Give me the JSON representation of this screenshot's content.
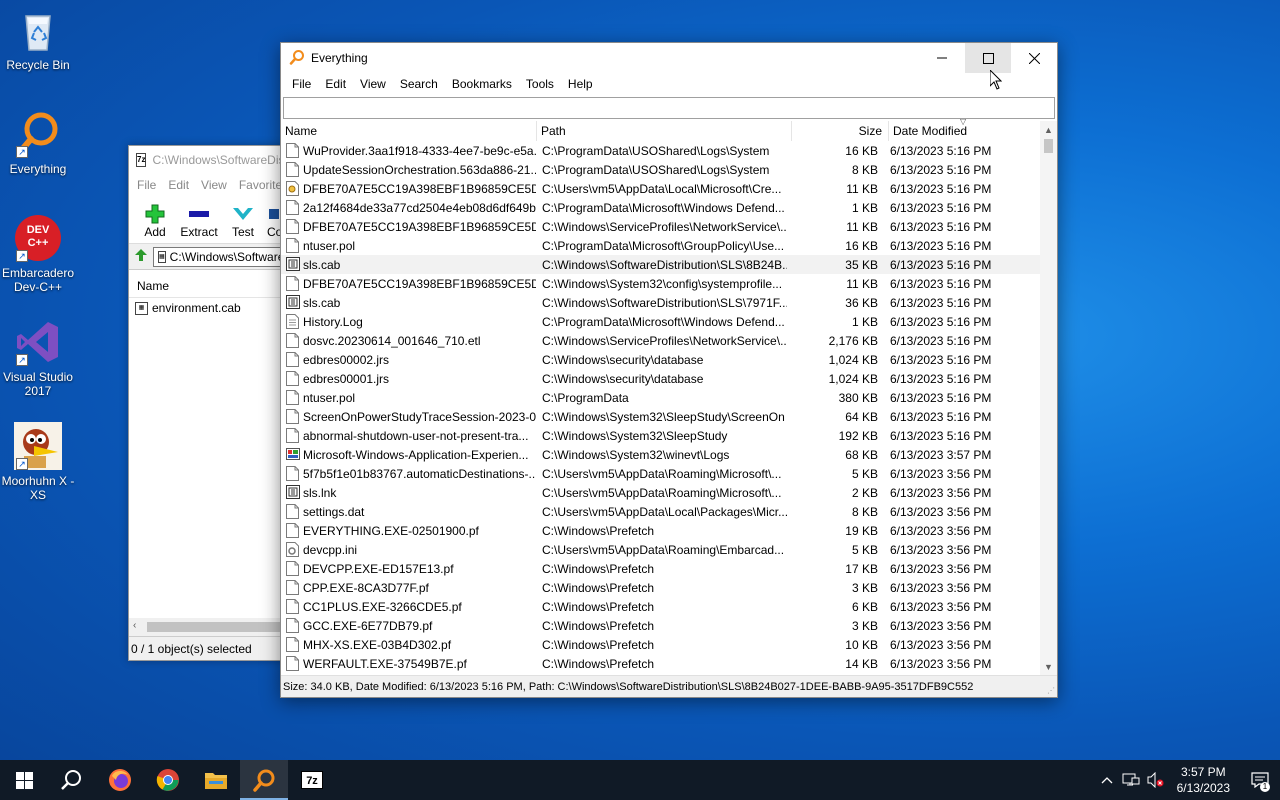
{
  "desktop": {
    "icons": [
      {
        "label": "Recycle Bin",
        "icon": "recycle-bin-icon"
      },
      {
        "label": "Everything",
        "icon": "everything-icon"
      },
      {
        "label": "Embarcadero Dev-C++",
        "icon": "devcpp-icon",
        "glyph_text": "DEV C++"
      },
      {
        "label": "Visual Studio 2017",
        "icon": "visual-studio-icon"
      },
      {
        "label": "Moorhuhn X - XS",
        "icon": "moorhuhn-icon"
      }
    ]
  },
  "sevenzip": {
    "title": "C:\\Windows\\SoftwareDistribution\\SLS\\",
    "app_icon_text": "7z",
    "menu": [
      "File",
      "Edit",
      "View",
      "Favorites"
    ],
    "toolbar": [
      {
        "label": "Add",
        "icon": "add-plus-icon"
      },
      {
        "label": "Extract",
        "icon": "extract-minus-icon"
      },
      {
        "label": "Test",
        "icon": "test-check-icon"
      },
      {
        "label": "Copy",
        "icon": "copy-icon"
      }
    ],
    "address": "C:\\Windows\\SoftwareDistribution\\SLS\\",
    "column_name": "Name",
    "files": [
      "environment.cab"
    ],
    "status": "0 / 1 object(s) selected"
  },
  "everything": {
    "title": "Everything",
    "menu": [
      "File",
      "Edit",
      "View",
      "Search",
      "Bookmarks",
      "Tools",
      "Help"
    ],
    "search_value": "",
    "columns": {
      "name": "Name",
      "path": "Path",
      "size": "Size",
      "date": "Date Modified"
    },
    "rows": [
      {
        "name": "WuProvider.3aa1f918-4333-4ee7-be9c-e5a...",
        "path": "C:\\ProgramData\\USOShared\\Logs\\System",
        "size": "16 KB",
        "date": "6/13/2023 5:16 PM",
        "icon": "file"
      },
      {
        "name": "UpdateSessionOrchestration.563da886-21...",
        "path": "C:\\ProgramData\\USOShared\\Logs\\System",
        "size": "8 KB",
        "date": "6/13/2023 5:16 PM",
        "icon": "file"
      },
      {
        "name": "DFBE70A7E5CC19A398EBF1B96859CE5D",
        "path": "C:\\Users\\vm5\\AppData\\Local\\Microsoft\\Cre...",
        "size": "11 KB",
        "date": "6/13/2023 5:16 PM",
        "icon": "cert"
      },
      {
        "name": "2a12f4684de33a77cd2504e4eb08d6df649b...",
        "path": "C:\\ProgramData\\Microsoft\\Windows Defend...",
        "size": "1 KB",
        "date": "6/13/2023 5:16 PM",
        "icon": "file"
      },
      {
        "name": "DFBE70A7E5CC19A398EBF1B96859CE5D",
        "path": "C:\\Windows\\ServiceProfiles\\NetworkService\\...",
        "size": "11 KB",
        "date": "6/13/2023 5:16 PM",
        "icon": "file"
      },
      {
        "name": "ntuser.pol",
        "path": "C:\\ProgramData\\Microsoft\\GroupPolicy\\Use...",
        "size": "16 KB",
        "date": "6/13/2023 5:16 PM",
        "icon": "file"
      },
      {
        "name": "sls.cab",
        "path": "C:\\Windows\\SoftwareDistribution\\SLS\\8B24B...",
        "size": "35 KB",
        "date": "6/13/2023 5:16 PM",
        "icon": "archive",
        "selected": true
      },
      {
        "name": "DFBE70A7E5CC19A398EBF1B96859CE5D",
        "path": "C:\\Windows\\System32\\config\\systemprofile...",
        "size": "11 KB",
        "date": "6/13/2023 5:16 PM",
        "icon": "file"
      },
      {
        "name": "sls.cab",
        "path": "C:\\Windows\\SoftwareDistribution\\SLS\\7971F...",
        "size": "36 KB",
        "date": "6/13/2023 5:16 PM",
        "icon": "archive"
      },
      {
        "name": "History.Log",
        "path": "C:\\ProgramData\\Microsoft\\Windows Defend...",
        "size": "1 KB",
        "date": "6/13/2023 5:16 PM",
        "icon": "text"
      },
      {
        "name": "dosvc.20230614_001646_710.etl",
        "path": "C:\\Windows\\ServiceProfiles\\NetworkService\\...",
        "size": "2,176 KB",
        "date": "6/13/2023 5:16 PM",
        "icon": "file"
      },
      {
        "name": "edbres00002.jrs",
        "path": "C:\\Windows\\security\\database",
        "size": "1,024 KB",
        "date": "6/13/2023 5:16 PM",
        "icon": "file"
      },
      {
        "name": "edbres00001.jrs",
        "path": "C:\\Windows\\security\\database",
        "size": "1,024 KB",
        "date": "6/13/2023 5:16 PM",
        "icon": "file"
      },
      {
        "name": "ntuser.pol",
        "path": "C:\\ProgramData",
        "size": "380 KB",
        "date": "6/13/2023 5:16 PM",
        "icon": "file"
      },
      {
        "name": "ScreenOnPowerStudyTraceSession-2023-0...",
        "path": "C:\\Windows\\System32\\SleepStudy\\ScreenOn",
        "size": "64 KB",
        "date": "6/13/2023 5:16 PM",
        "icon": "file"
      },
      {
        "name": "abnormal-shutdown-user-not-present-tra...",
        "path": "C:\\Windows\\System32\\SleepStudy",
        "size": "192 KB",
        "date": "6/13/2023 5:16 PM",
        "icon": "file"
      },
      {
        "name": "Microsoft-Windows-Application-Experien...",
        "path": "C:\\Windows\\System32\\winevt\\Logs",
        "size": "68 KB",
        "date": "6/13/2023 3:57 PM",
        "icon": "evtx"
      },
      {
        "name": "5f7b5f1e01b83767.automaticDestinations-...",
        "path": "C:\\Users\\vm5\\AppData\\Roaming\\Microsoft\\...",
        "size": "5 KB",
        "date": "6/13/2023 3:56 PM",
        "icon": "file"
      },
      {
        "name": "sls.lnk",
        "path": "C:\\Users\\vm5\\AppData\\Roaming\\Microsoft\\...",
        "size": "2 KB",
        "date": "6/13/2023 3:56 PM",
        "icon": "archive"
      },
      {
        "name": "settings.dat",
        "path": "C:\\Users\\vm5\\AppData\\Local\\Packages\\Micr...",
        "size": "8 KB",
        "date": "6/13/2023 3:56 PM",
        "icon": "file"
      },
      {
        "name": "EVERYTHING.EXE-02501900.pf",
        "path": "C:\\Windows\\Prefetch",
        "size": "19 KB",
        "date": "6/13/2023 3:56 PM",
        "icon": "file"
      },
      {
        "name": "devcpp.ini",
        "path": "C:\\Users\\vm5\\AppData\\Roaming\\Embarcad...",
        "size": "5 KB",
        "date": "6/13/2023 3:56 PM",
        "icon": "ini"
      },
      {
        "name": "DEVCPP.EXE-ED157E13.pf",
        "path": "C:\\Windows\\Prefetch",
        "size": "17 KB",
        "date": "6/13/2023 3:56 PM",
        "icon": "file"
      },
      {
        "name": "CPP.EXE-8CA3D77F.pf",
        "path": "C:\\Windows\\Prefetch",
        "size": "3 KB",
        "date": "6/13/2023 3:56 PM",
        "icon": "file"
      },
      {
        "name": "CC1PLUS.EXE-3266CDE5.pf",
        "path": "C:\\Windows\\Prefetch",
        "size": "6 KB",
        "date": "6/13/2023 3:56 PM",
        "icon": "file"
      },
      {
        "name": "GCC.EXE-6E77DB79.pf",
        "path": "C:\\Windows\\Prefetch",
        "size": "3 KB",
        "date": "6/13/2023 3:56 PM",
        "icon": "file"
      },
      {
        "name": "MHX-XS.EXE-03B4D302.pf",
        "path": "C:\\Windows\\Prefetch",
        "size": "10 KB",
        "date": "6/13/2023 3:56 PM",
        "icon": "file"
      },
      {
        "name": "WERFAULT.EXE-37549B7E.pf",
        "path": "C:\\Windows\\Prefetch",
        "size": "14 KB",
        "date": "6/13/2023 3:56 PM",
        "icon": "file"
      }
    ],
    "status": "Size: 34.0 KB, Date Modified: 6/13/2023 5:16 PM, Path: C:\\Windows\\SoftwareDistribution\\SLS\\8B24B027-1DEE-BABB-9A95-3517DFB9C552"
  },
  "taskbar": {
    "items": [
      {
        "name": "start-button",
        "icon": "windows-logo-icon"
      },
      {
        "name": "search-button",
        "icon": "search-icon"
      },
      {
        "name": "firefox-taskbar-item",
        "icon": "firefox-icon"
      },
      {
        "name": "chrome-taskbar-item",
        "icon": "chrome-icon"
      },
      {
        "name": "file-explorer-taskbar-item",
        "icon": "folder-icon"
      },
      {
        "name": "everything-taskbar-item",
        "icon": "everything-icon",
        "active": true
      },
      {
        "name": "7zip-taskbar-item",
        "icon": "7zip-icon",
        "text": "7z"
      }
    ],
    "time": "3:57 PM",
    "date": "6/13/2023",
    "notification_count": "1"
  },
  "colors": {
    "accent": "#0a64c8",
    "everything_orange": "#f28c1c",
    "taskbar": "#101a26"
  }
}
